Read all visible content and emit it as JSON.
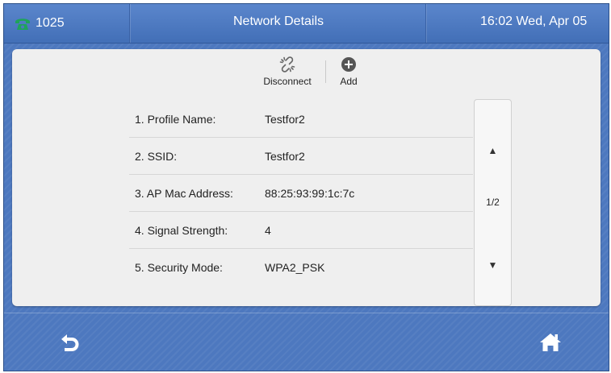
{
  "statusbar": {
    "extension": "1025",
    "title": "Network Details",
    "clock": "16:02 Wed, Apr 05"
  },
  "toolbar": {
    "disconnect_label": "Disconnect",
    "add_label": "Add"
  },
  "details": [
    {
      "label": "1. Profile Name:",
      "value": "Testfor2"
    },
    {
      "label": "2. SSID:",
      "value": "Testfor2"
    },
    {
      "label": "3. AP Mac Address:",
      "value": "88:25:93:99:1c:7c"
    },
    {
      "label": "4. Signal Strength:",
      "value": "4"
    },
    {
      "label": "5. Security Mode:",
      "value": "WPA2_PSK"
    }
  ],
  "scroller": {
    "up": "▲",
    "page": "1/2",
    "down": "▼"
  },
  "softkeys": {
    "back_icon": "back-arrow-icon",
    "home_icon": "home-icon"
  },
  "colors": {
    "status_green": "#1fa35b",
    "bar_blue": "#4d78bf",
    "panel_gray": "#efefef"
  }
}
